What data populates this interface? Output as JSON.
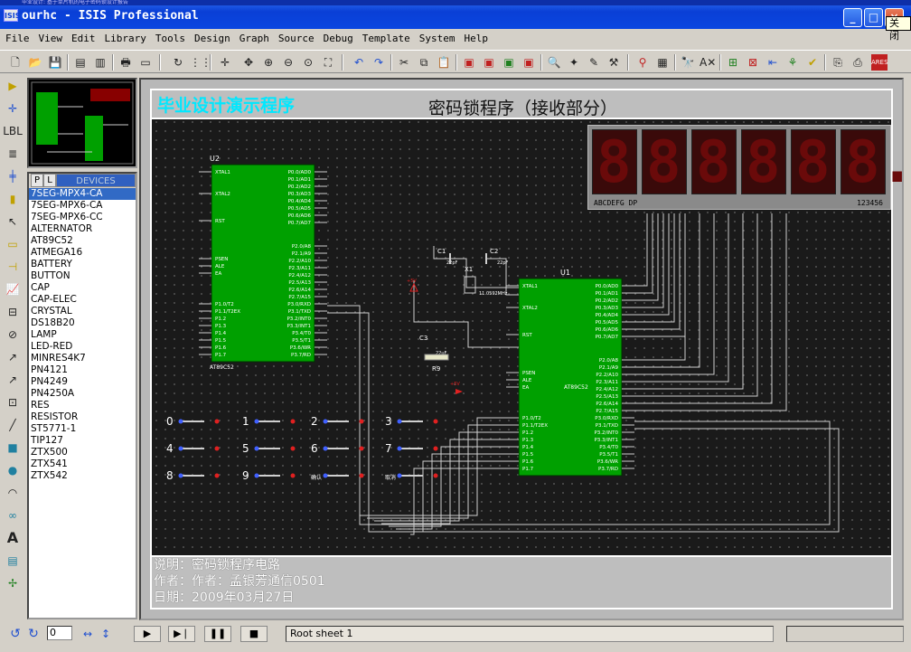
{
  "window": {
    "title": "ourhc - ISIS Professional",
    "top_strip": "毕业设计: 基于单片机的电子密码锁设计报告",
    "logo": "ISIS",
    "tooltip": "关闭",
    "btn_min": "_",
    "btn_max": "□",
    "btn_close": "×"
  },
  "menu": [
    "File",
    "View",
    "Edit",
    "Library",
    "Tools",
    "Design",
    "Graph",
    "Source",
    "Debug",
    "Template",
    "System",
    "Help"
  ],
  "devices": {
    "tab_p": "P",
    "tab_l": "L",
    "header": "DEVICES",
    "items": [
      "7SEG-MPX4-CA",
      "7SEG-MPX6-CA",
      "7SEG-MPX6-CC",
      "ALTERNATOR",
      "AT89C52",
      "ATMEGA16",
      "BATTERY",
      "BUTTON",
      "CAP",
      "CAP-ELEC",
      "CRYSTAL",
      "DS18B20",
      "LAMP",
      "LED-RED",
      "MINRES4K7",
      "PN4121",
      "PN4249",
      "PN4250A",
      "RES",
      "RESISTOR",
      "ST5771-1",
      "TIP127",
      "ZTX500",
      "ZTX541",
      "ZTX542"
    ],
    "selected": 0
  },
  "sheet": {
    "project_title": "毕业设计演示程序",
    "subtitle": "密码锁程序（接收部分）",
    "desc": "说明：密码锁程序电路",
    "author": "作者：作者：孟银芳通信0501",
    "date": "日期：2009年03月27日"
  },
  "display": {
    "digits": [
      "8.",
      "8.",
      "8.",
      "8.",
      "8.",
      "8."
    ],
    "label_left": "ABCDEFG DP",
    "label_right": "123456"
  },
  "schematic": {
    "u2_ref": "U2",
    "u2_part": "AT89C52",
    "u1_ref": "U1",
    "u1_part": "AT89C52",
    "left_pins": [
      "XTAL1",
      "XTAL2",
      "RST",
      "PSEN",
      "ALE",
      "EA",
      "P1.0/T2",
      "P1.1/T2EX",
      "P1.2",
      "P1.3",
      "P1.4",
      "P1.5",
      "P1.6",
      "P1.7"
    ],
    "right_p0": [
      "P0.0/AD0",
      "P0.1/AD1",
      "P0.2/AD2",
      "P0.3/AD3",
      "P0.4/AD4",
      "P0.5/AD5",
      "P0.6/AD6",
      "P0.7/AD7"
    ],
    "right_p2": [
      "P2.0/A8",
      "P2.1/A9",
      "P2.2/A10",
      "P2.3/A11",
      "P2.4/A12",
      "P2.5/A13",
      "P2.6/A14",
      "P2.7/A15"
    ],
    "right_p3": [
      "P3.0/RXD",
      "P3.1/TXD",
      "P3.2/INT0",
      "P3.3/INT1",
      "P3.4/T0",
      "P3.5/T1",
      "P3.6/WR",
      "P3.7/RD"
    ],
    "c1": "C1",
    "c2": "C2",
    "c3": "C3",
    "cap_val": "22pF",
    "c3_val": "22uF",
    "x1": "X1",
    "x1_val": "11.0592MHz",
    "r9": "R9",
    "vcc": "+5V",
    "keys": [
      "0",
      "1",
      "2",
      "3",
      "4",
      "5",
      "6",
      "7",
      "8",
      "9",
      "确认",
      "取消"
    ]
  },
  "status": {
    "sheet_name": "Root sheet 1",
    "zoom_value": "0"
  },
  "colors": {
    "chip_fill": "#00a000",
    "wire": "#cfcfcf",
    "project_title": "#00e8ff",
    "seg_off": "#6a0a0a"
  }
}
